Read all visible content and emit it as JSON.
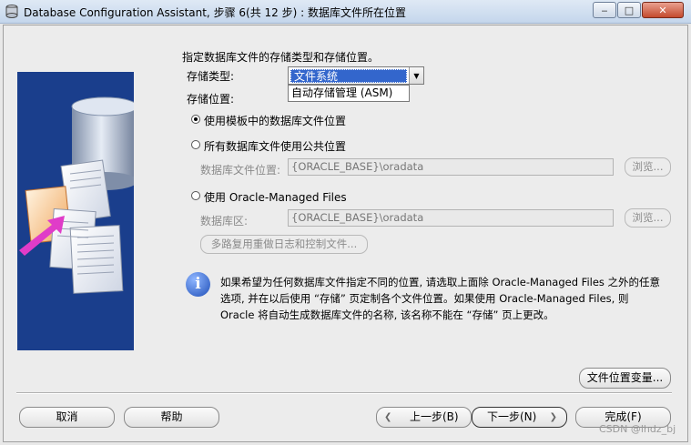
{
  "window": {
    "title": "Database Configuration Assistant, 步骤 6(共 12 步) : 数据库文件所在位置",
    "minimize_symbol": "‒",
    "maximize_symbol": "□",
    "close_symbol": "✕"
  },
  "main": {
    "heading": "指定数据库文件的存储类型和存储位置。",
    "storage_type_label": "存储类型:",
    "storage_type_selected": "文件系统",
    "storage_type_options": [
      "文件系统",
      "自动存储管理 (ASM)"
    ],
    "storage_location_label": "存储位置:",
    "radio_template": "使用模板中的数据库文件位置",
    "radio_common": "所有数据库文件使用公共位置",
    "db_file_location_label": "数据库文件位置:",
    "db_file_location_value": "{ORACLE_BASE}\\oradata",
    "browse_label": "浏览...",
    "radio_omf": "使用 Oracle-Managed Files",
    "db_area_label": "数据库区:",
    "db_area_value": "{ORACLE_BASE}\\oradata",
    "browse2_label": "浏览...",
    "multiplex_label": "多路复用重做日志和控制文件...",
    "info_lines": [
      "如果希望为任何数据库文件指定不同的位置, 请选取上面除 Oracle-Managed Files 之外的任意",
      "选项, 并在以后使用 “存储” 页定制各个文件位置。如果使用 Oracle-Managed Files, 则",
      "Oracle 将自动生成数据库文件的名称, 该名称不能在 “存储” 页上更改。"
    ],
    "file_location_vars_label": "文件位置变量..."
  },
  "footer": {
    "cancel": "取消",
    "help": "帮助",
    "back": "上一步(B)",
    "next": "下一步(N)",
    "finish": "完成(F)"
  },
  "watermark": "CSDN @lhdz_bj",
  "colors": {
    "selection": "#3366cc",
    "panel": "#1a3e8c",
    "arrow": "#e03cc8"
  }
}
